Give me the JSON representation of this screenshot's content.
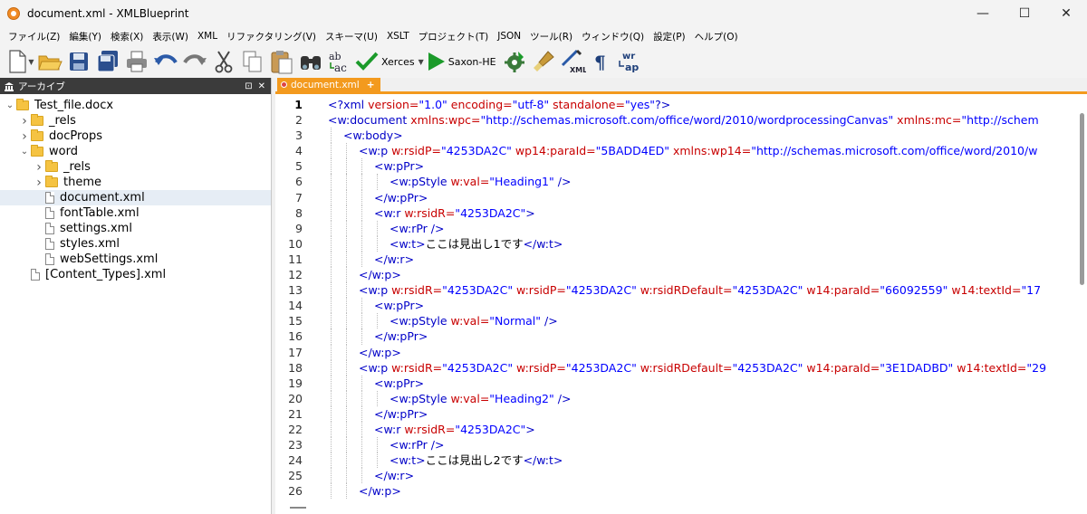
{
  "window": {
    "title": "document.xml - XMLBlueprint",
    "minimize": "—",
    "maximize": "☐",
    "close": "✕"
  },
  "menu": [
    "ファイル(Z)",
    "編集(Y)",
    "検索(X)",
    "表示(W)",
    "XML",
    "リファクタリング(V)",
    "スキーマ(U)",
    "XSLT",
    "プロジェクト(T)",
    "JSON",
    "ツール(R)",
    "ウィンドウ(Q)",
    "設定(P)",
    "ヘルプ(O)"
  ],
  "toolbar": {
    "xerces_label": "Xerces",
    "saxon_label": "Saxon-HE",
    "icons": [
      "new-file-icon",
      "open-folder-icon",
      "save-icon",
      "save-all-icon",
      "print-icon",
      "undo-icon",
      "redo-icon",
      "cut-icon",
      "copy-icon",
      "paste-icon",
      "find-icon",
      "replace-icon",
      "validate-check-icon",
      "run-transform-icon",
      "settings-gear-icon",
      "format-brush-icon",
      "xml-wand-icon",
      "pilcrow-icon",
      "word-wrap-icon"
    ]
  },
  "archive_panel": {
    "title": "アーカイブ",
    "pin": "⊡",
    "close": "✕",
    "tree": [
      {
        "label": "Test_file.docx",
        "type": "folder",
        "level": 0,
        "expanded": true
      },
      {
        "label": "_rels",
        "type": "folder",
        "level": 1,
        "expanded": false
      },
      {
        "label": "docProps",
        "type": "folder",
        "level": 1,
        "expanded": false
      },
      {
        "label": "word",
        "type": "folder",
        "level": 1,
        "expanded": true
      },
      {
        "label": "_rels",
        "type": "folder",
        "level": 2,
        "expanded": false
      },
      {
        "label": "theme",
        "type": "folder",
        "level": 2,
        "expanded": false
      },
      {
        "label": "document.xml",
        "type": "file",
        "level": 2,
        "selected": true
      },
      {
        "label": "fontTable.xml",
        "type": "file",
        "level": 2
      },
      {
        "label": "settings.xml",
        "type": "file",
        "level": 2
      },
      {
        "label": "styles.xml",
        "type": "file",
        "level": 2
      },
      {
        "label": "webSettings.xml",
        "type": "file",
        "level": 2
      },
      {
        "label": "[Content_Types].xml",
        "type": "file",
        "level": 1
      }
    ]
  },
  "editor": {
    "tab_label": "document.xml",
    "tab_add": "+",
    "current_line": 1,
    "lines": [
      [
        [
          "pi",
          "<?xml "
        ],
        [
          "attr",
          "version="
        ],
        [
          "val",
          "\"1.0\""
        ],
        [
          "attr",
          " encoding="
        ],
        [
          "val",
          "\"utf-8\""
        ],
        [
          "attr",
          " standalone="
        ],
        [
          "val",
          "\"yes\""
        ],
        [
          "pi",
          "?>"
        ]
      ],
      [
        [
          "tag",
          "<w:document "
        ],
        [
          "attr",
          "xmlns:wpc="
        ],
        [
          "val",
          "\"http://schemas.microsoft.com/office/word/2010/wordprocessingCanvas\""
        ],
        [
          "attr",
          " xmlns:mc="
        ],
        [
          "val",
          "\"http://schem"
        ]
      ],
      [
        [
          "tag",
          "<w:body>"
        ]
      ],
      [
        [
          "tag",
          "<w:p "
        ],
        [
          "attr",
          "w:rsidP="
        ],
        [
          "val",
          "\"4253DA2C\""
        ],
        [
          "attr",
          " wp14:paraId="
        ],
        [
          "val",
          "\"5BADD4ED\""
        ],
        [
          "attr",
          " xmlns:wp14="
        ],
        [
          "val",
          "\"http://schemas.microsoft.com/office/word/2010/w"
        ]
      ],
      [
        [
          "tag",
          "<w:pPr>"
        ]
      ],
      [
        [
          "tag",
          "<w:pStyle "
        ],
        [
          "attr",
          "w:val="
        ],
        [
          "val",
          "\"Heading1\""
        ],
        [
          "tag",
          " />"
        ]
      ],
      [
        [
          "tag",
          "</w:pPr>"
        ]
      ],
      [
        [
          "tag",
          "<w:r "
        ],
        [
          "attr",
          "w:rsidR="
        ],
        [
          "val",
          "\"4253DA2C\""
        ],
        [
          "tag",
          ">"
        ]
      ],
      [
        [
          "tag",
          "<w:rPr />"
        ]
      ],
      [
        [
          "tag",
          "<w:t>"
        ],
        [
          "txt",
          "ここは見出し1です"
        ],
        [
          "tag",
          "</w:t>"
        ]
      ],
      [
        [
          "tag",
          "</w:r>"
        ]
      ],
      [
        [
          "tag",
          "</w:p>"
        ]
      ],
      [
        [
          "tag",
          "<w:p "
        ],
        [
          "attr",
          "w:rsidR="
        ],
        [
          "val",
          "\"4253DA2C\""
        ],
        [
          "attr",
          " w:rsidP="
        ],
        [
          "val",
          "\"4253DA2C\""
        ],
        [
          "attr",
          " w:rsidRDefault="
        ],
        [
          "val",
          "\"4253DA2C\""
        ],
        [
          "attr",
          " w14:paraId="
        ],
        [
          "val",
          "\"66092559\""
        ],
        [
          "attr",
          " w14:textId="
        ],
        [
          "val",
          "\"17"
        ]
      ],
      [
        [
          "tag",
          "<w:pPr>"
        ]
      ],
      [
        [
          "tag",
          "<w:pStyle "
        ],
        [
          "attr",
          "w:val="
        ],
        [
          "val",
          "\"Normal\""
        ],
        [
          "tag",
          " />"
        ]
      ],
      [
        [
          "tag",
          "</w:pPr>"
        ]
      ],
      [
        [
          "tag",
          "</w:p>"
        ]
      ],
      [
        [
          "tag",
          "<w:p "
        ],
        [
          "attr",
          "w:rsidR="
        ],
        [
          "val",
          "\"4253DA2C\""
        ],
        [
          "attr",
          " w:rsidP="
        ],
        [
          "val",
          "\"4253DA2C\""
        ],
        [
          "attr",
          " w:rsidRDefault="
        ],
        [
          "val",
          "\"4253DA2C\""
        ],
        [
          "attr",
          " w14:paraId="
        ],
        [
          "val",
          "\"3E1DADBD\""
        ],
        [
          "attr",
          " w14:textId="
        ],
        [
          "val",
          "\"29"
        ]
      ],
      [
        [
          "tag",
          "<w:pPr>"
        ]
      ],
      [
        [
          "tag",
          "<w:pStyle "
        ],
        [
          "attr",
          "w:val="
        ],
        [
          "val",
          "\"Heading2\""
        ],
        [
          "tag",
          " />"
        ]
      ],
      [
        [
          "tag",
          "</w:pPr>"
        ]
      ],
      [
        [
          "tag",
          "<w:r "
        ],
        [
          "attr",
          "w:rsidR="
        ],
        [
          "val",
          "\"4253DA2C\""
        ],
        [
          "tag",
          ">"
        ]
      ],
      [
        [
          "tag",
          "<w:rPr />"
        ]
      ],
      [
        [
          "tag",
          "<w:t>"
        ],
        [
          "txt",
          "ここは見出し2です"
        ],
        [
          "tag",
          "</w:t>"
        ]
      ],
      [
        [
          "tag",
          "</w:r>"
        ]
      ],
      [
        [
          "tag",
          "</w:p>"
        ]
      ]
    ],
    "indents": [
      0,
      0,
      1,
      2,
      3,
      4,
      3,
      3,
      4,
      4,
      3,
      2,
      2,
      3,
      4,
      3,
      2,
      2,
      3,
      4,
      3,
      3,
      4,
      4,
      3,
      2
    ]
  },
  "colors": {
    "accent_orange": "#f39a1e",
    "tag": "#0000c8",
    "attribute": "#c80000",
    "value": "#0000ff"
  }
}
